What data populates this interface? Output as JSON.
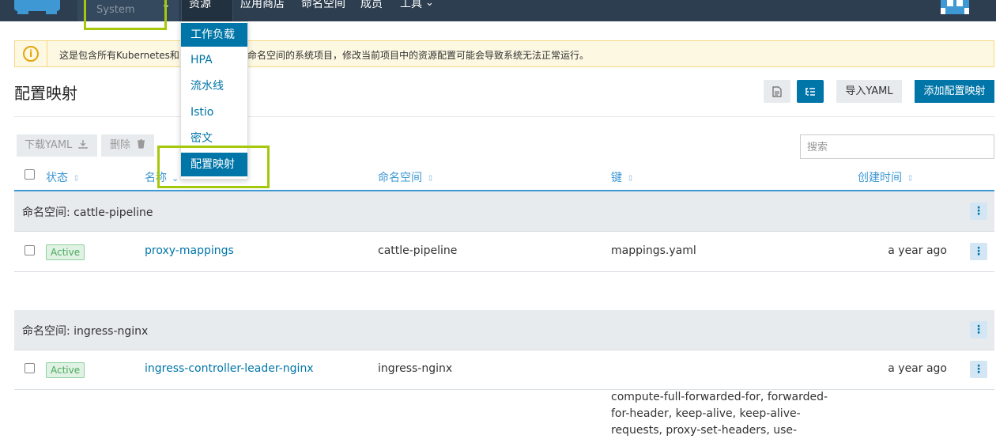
{
  "nav": {
    "project": "System",
    "items": [
      "资源",
      "应用商店",
      "命名空间",
      "成员",
      "工具"
    ]
  },
  "dropdown": {
    "items": [
      "工作负载",
      "HPA",
      "流水线",
      "Istio",
      "密文",
      "配置映射"
    ]
  },
  "warning": {
    "icon_glyph": "i",
    "text_a": "这是包含所有Kubernetes和",
    "text_b": "命名空间的系统项目，修改当前项目中的资源配置可能会导致系统无法正常运行。"
  },
  "page": {
    "title": "配置映射",
    "import_label": "导入YAML",
    "add_label": "添加配置映射",
    "download_label": "下载YAML",
    "delete_label": "删除",
    "search_placeholder": "搜索"
  },
  "table": {
    "headers": [
      "状态",
      "名称",
      "命名空间",
      "键",
      "创建时间"
    ],
    "groups": [
      {
        "label": "命名空间: cattle-pipeline",
        "rows": [
          {
            "status": "Active",
            "name": "proxy-mappings",
            "namespace": "cattle-pipeline",
            "keys": "mappings.yaml",
            "created": "a year ago"
          }
        ]
      },
      {
        "label": "命名空间: ingress-nginx",
        "rows": [
          {
            "status": "Active",
            "name": "ingress-controller-leader-nginx",
            "namespace": "ingress-nginx",
            "keys": "",
            "created": "a year ago"
          }
        ]
      }
    ],
    "trailing_keys": "compute-full-forwarded-for, forwarded-for-header, keep-alive, keep-alive-requests, proxy-set-headers, use-"
  },
  "colors": {
    "accent": "#0075a8",
    "highlight": "#a5c80c",
    "topbar": "#2c3e50"
  }
}
